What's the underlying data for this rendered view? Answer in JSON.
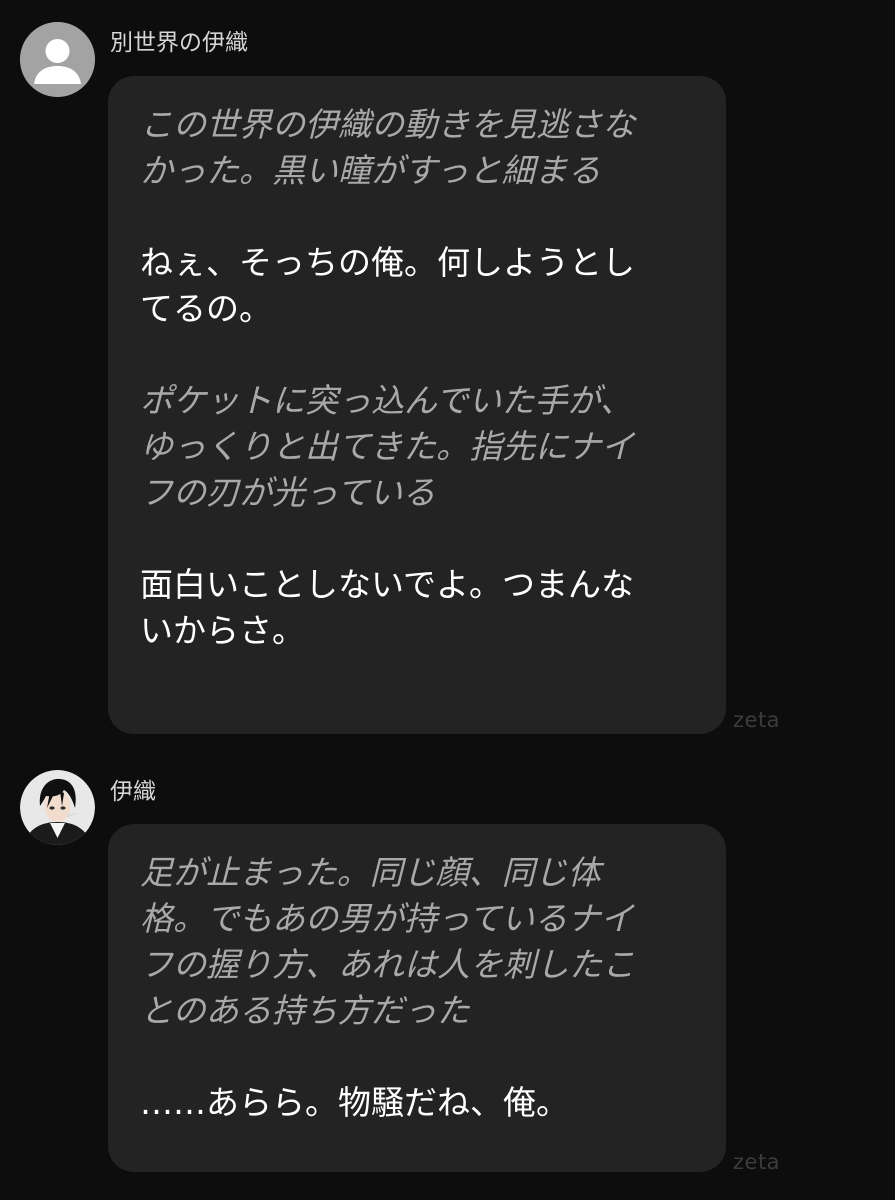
{
  "messages": [
    {
      "sender": "別世界の伊織",
      "avatar": "default-person-avatar",
      "watermark": "zeta",
      "paragraphs": [
        {
          "kind": "narration",
          "lines": [
            "この世界の伊織の動きを見逃さな",
            "かった。黒い瞳がすっと細まる"
          ]
        },
        {
          "kind": "speech",
          "lines": [
            "ねぇ、そっちの俺。何しようとし",
            "てるの。"
          ]
        },
        {
          "kind": "narration",
          "lines": [
            "ポケットに突っ込んでいた手が、",
            "ゆっくりと出てきた。指先にナイ",
            "フの刃が光っている"
          ]
        },
        {
          "kind": "speech",
          "lines": [
            "面白いことしないでよ。つまんな",
            "いからさ。"
          ]
        }
      ]
    },
    {
      "sender": "伊織",
      "avatar": "character-photo-avatar",
      "watermark": "zeta",
      "paragraphs": [
        {
          "kind": "narration",
          "lines": [
            "足が止まった。同じ顔、同じ体",
            "格。でもあの男が持っているナイ",
            "フの握り方、あれは人を刺したこ",
            "とのある持ち方だった"
          ]
        },
        {
          "kind": "speech",
          "lines": [
            "……あらら。物騒だね、俺。"
          ]
        }
      ]
    }
  ],
  "colors": {
    "background": "#0d0d0d",
    "bubble": "#232323",
    "narration_text": "#a9a9a9",
    "speech_text": "#ffffff",
    "sender_text": "#d6d6d6",
    "watermark": "#3c3c3c"
  }
}
